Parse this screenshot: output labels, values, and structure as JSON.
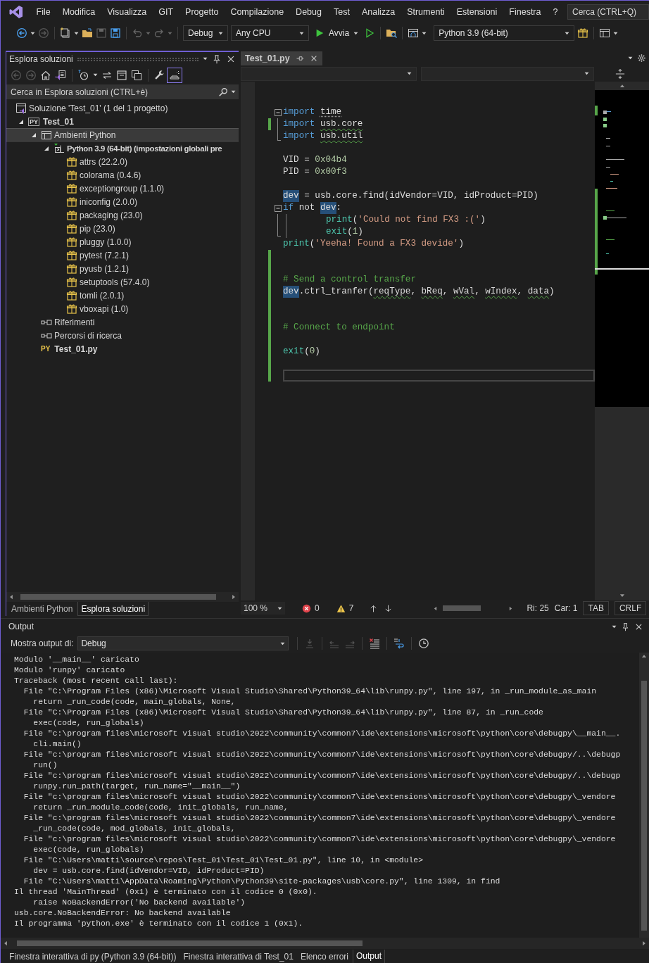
{
  "menu": {
    "items": [
      "File",
      "Modifica",
      "Visualizza",
      "GIT",
      "Progetto",
      "Compilazione",
      "Debug",
      "Test",
      "Analizza",
      "Strumenti",
      "Estensioni",
      "Finestra",
      "?"
    ],
    "search": {
      "placeholder": "Cerca (CTRL+Q)"
    }
  },
  "toolbar": {
    "configuration": "Debug",
    "platform": "Any CPU",
    "start": "Avvia",
    "environment": "Python 3.9 (64-bit)"
  },
  "solution_explorer": {
    "title": "Esplora soluzioni",
    "preview_on": true,
    "search": {
      "placeholder": "Cerca in Esplora soluzioni (CTRL+è)"
    },
    "tree": [
      {
        "kind": "solution",
        "label": "Soluzione 'Test_01' (1 del 1 progetto)",
        "selected": false,
        "children": [
          {
            "kind": "project",
            "badge": "PY",
            "label": "Test_01",
            "expanded": true,
            "selected": false,
            "children": [
              {
                "kind": "folder",
                "label": "Ambienti Python",
                "expanded": true,
                "selected": true,
                "children": [
                  {
                    "kind": "environment",
                    "label": "Python 3.9 (64-bit) (impostazioni globali pre",
                    "expanded": true,
                    "selected": false,
                    "children": [
                      {
                        "kind": "package",
                        "label": "attrs (22.2.0)",
                        "selected": false
                      },
                      {
                        "kind": "package",
                        "label": "colorama (0.4.6)",
                        "selected": false
                      },
                      {
                        "kind": "package",
                        "label": "exceptiongroup (1.1.0)",
                        "selected": false
                      },
                      {
                        "kind": "package",
                        "label": "iniconfig (2.0.0)",
                        "selected": false
                      },
                      {
                        "kind": "package",
                        "label": "packaging (23.0)",
                        "selected": false
                      },
                      {
                        "kind": "package",
                        "label": "pip (23.0)",
                        "selected": false
                      },
                      {
                        "kind": "package",
                        "label": "pluggy (1.0.0)",
                        "selected": false
                      },
                      {
                        "kind": "package",
                        "label": "pytest (7.2.1)",
                        "selected": false
                      },
                      {
                        "kind": "package",
                        "label": "pyusb (1.2.1)",
                        "selected": false
                      },
                      {
                        "kind": "package",
                        "label": "setuptools (57.4.0)",
                        "selected": false
                      },
                      {
                        "kind": "package",
                        "label": "tomli (2.0.1)",
                        "selected": false
                      },
                      {
                        "kind": "package",
                        "label": "vboxapi (1.0)",
                        "selected": false
                      }
                    ]
                  }
                ]
              },
              {
                "kind": "reference",
                "label": "Riferimenti",
                "selected": false
              },
              {
                "kind": "reference",
                "label": "Percorsi di ricerca",
                "selected": false
              },
              {
                "kind": "file",
                "badge": "PY",
                "label": "Test_01.py",
                "selected": false
              }
            ]
          }
        ]
      }
    ],
    "tabs": [
      {
        "label": "Ambienti Python",
        "selected": false
      },
      {
        "label": "Esplora soluzioni",
        "selected": true
      }
    ]
  },
  "editor": {
    "tabs": [
      {
        "label": "Test_01.py",
        "selected": true
      }
    ],
    "lines": [
      {
        "kind": "blank",
        "changed": false,
        "current": false
      },
      {
        "kind": "blank",
        "changed": false,
        "current": false
      },
      {
        "kind": "code",
        "changed": false,
        "current": false,
        "collapsible": true,
        "tokens": [
          {
            "t": "import ",
            "kind": "kw"
          },
          {
            "t": "time",
            "kind": "hint"
          }
        ]
      },
      {
        "kind": "code",
        "changed": true,
        "current": false,
        "in_block": true,
        "tokens": [
          {
            "t": "import ",
            "kind": "kw"
          },
          {
            "t": "usb.core",
            "kind": "err"
          }
        ]
      },
      {
        "kind": "code",
        "changed": false,
        "current": false,
        "block_end": true,
        "tokens": [
          {
            "t": "import ",
            "kind": "kw"
          },
          {
            "t": "usb.util",
            "kind": "err"
          }
        ]
      },
      {
        "kind": "blank",
        "changed": false,
        "current": false
      },
      {
        "kind": "code",
        "changed": false,
        "current": false,
        "tokens": [
          {
            "t": "VID = ",
            "kind": "id"
          },
          {
            "t": "0x04b4",
            "kind": "num"
          }
        ]
      },
      {
        "kind": "code",
        "changed": false,
        "current": false,
        "tokens": [
          {
            "t": "PID = ",
            "kind": "id"
          },
          {
            "t": "0x00f3",
            "kind": "num"
          }
        ]
      },
      {
        "kind": "blank",
        "changed": false,
        "current": false
      },
      {
        "kind": "code",
        "changed": false,
        "current": false,
        "tokens": [
          {
            "t": "dev",
            "kind": "ref"
          },
          {
            "t": " = usb.core.find(idVendor=VID, idProduct=PID)",
            "kind": "id"
          }
        ]
      },
      {
        "kind": "code",
        "changed": false,
        "current": false,
        "collapsible": true,
        "tokens": [
          {
            "t": "if",
            "kind": "kw"
          },
          {
            "t": " not ",
            "kind": "id"
          },
          {
            "t": "dev",
            "kind": "ref"
          },
          {
            "t": ":",
            "kind": "id"
          }
        ]
      },
      {
        "kind": "code",
        "changed": false,
        "current": false,
        "in_block": true,
        "indented": true,
        "tokens": [
          {
            "t": "print",
            "kind": "fn"
          },
          {
            "t": "(",
            "kind": "id"
          },
          {
            "t": "'Could not find FX3 :('",
            "kind": "str"
          },
          {
            "t": ")",
            "kind": "id"
          }
        ]
      },
      {
        "kind": "code",
        "changed": false,
        "current": false,
        "block_end": true,
        "indented": true,
        "tokens": [
          {
            "t": "exit",
            "kind": "fn"
          },
          {
            "t": "(",
            "kind": "id"
          },
          {
            "t": "1",
            "kind": "num"
          },
          {
            "t": ")",
            "kind": "id"
          }
        ]
      },
      {
        "kind": "code",
        "changed": false,
        "current": false,
        "tokens": [
          {
            "t": "print",
            "kind": "fn"
          },
          {
            "t": "(",
            "kind": "id"
          },
          {
            "t": "'Yeeha! Found a FX3 devide'",
            "kind": "str"
          },
          {
            "t": ")",
            "kind": "id"
          }
        ]
      },
      {
        "kind": "blank",
        "changed": true,
        "current": false
      },
      {
        "kind": "blank",
        "changed": true,
        "current": false
      },
      {
        "kind": "code",
        "changed": true,
        "current": false,
        "tokens": [
          {
            "t": "# Send a control transfer",
            "kind": "cm"
          }
        ]
      },
      {
        "kind": "code",
        "changed": true,
        "current": false,
        "tokens": [
          {
            "t": "dev",
            "kind": "ref"
          },
          {
            "t": ".ctrl_tranfer(",
            "kind": "id"
          },
          {
            "t": "reqType",
            "kind": "err"
          },
          {
            "t": ", ",
            "kind": "id"
          },
          {
            "t": "bReq",
            "kind": "err"
          },
          {
            "t": ", ",
            "kind": "id"
          },
          {
            "t": "wVal",
            "kind": "err"
          },
          {
            "t": ", ",
            "kind": "id"
          },
          {
            "t": "wIndex",
            "kind": "err"
          },
          {
            "t": ", ",
            "kind": "id"
          },
          {
            "t": "data",
            "kind": "err"
          },
          {
            "t": ")",
            "kind": "id"
          }
        ]
      },
      {
        "kind": "blank",
        "changed": true,
        "current": false
      },
      {
        "kind": "blank",
        "changed": true,
        "current": false
      },
      {
        "kind": "code",
        "changed": true,
        "current": false,
        "tokens": [
          {
            "t": "# Connect to endpoint",
            "kind": "cm"
          }
        ]
      },
      {
        "kind": "blank",
        "changed": true,
        "current": false
      },
      {
        "kind": "code",
        "changed": true,
        "current": false,
        "tokens": [
          {
            "t": "exit",
            "kind": "fn"
          },
          {
            "t": "(",
            "kind": "id"
          },
          {
            "t": "0",
            "kind": "num"
          },
          {
            "t": ")",
            "kind": "id"
          }
        ]
      },
      {
        "kind": "blank",
        "changed": true,
        "current": false
      },
      {
        "kind": "blank",
        "changed": true,
        "current": true
      }
    ],
    "status": {
      "zoom": "100 %",
      "errors": "0",
      "warnings": "7",
      "line": "Ri: 25",
      "column": "Car: 1",
      "indent": "TAB",
      "line_ending": "CRLF"
    }
  },
  "output": {
    "title": "Output",
    "source_label": "Mostra output di:",
    "source": "Debug",
    "lines": [
      "Modulo '__main__' caricato",
      "Modulo 'runpy' caricato",
      "Traceback (most recent call last):",
      "  File \"C:\\Program Files (x86)\\Microsoft Visual Studio\\Shared\\Python39_64\\lib\\runpy.py\", line 197, in _run_module_as_main",
      "    return _run_code(code, main_globals, None,",
      "  File \"C:\\Program Files (x86)\\Microsoft Visual Studio\\Shared\\Python39_64\\lib\\runpy.py\", line 87, in _run_code",
      "    exec(code, run_globals)",
      "  File \"c:\\program files\\microsoft visual studio\\2022\\community\\common7\\ide\\extensions\\microsoft\\python\\core\\debugpy\\__main__.",
      "    cli.main()",
      "  File \"c:\\program files\\microsoft visual studio\\2022\\community\\common7\\ide\\extensions\\microsoft\\python\\core\\debugpy/..\\debugp",
      "    run()",
      "  File \"c:\\program files\\microsoft visual studio\\2022\\community\\common7\\ide\\extensions\\microsoft\\python\\core\\debugpy/..\\debugp",
      "    runpy.run_path(target, run_name=\"__main__\")",
      "  File \"c:\\program files\\microsoft visual studio\\2022\\community\\common7\\ide\\extensions\\microsoft\\python\\core\\debugpy\\_vendore",
      "    return _run_module_code(code, init_globals, run_name,",
      "  File \"c:\\program files\\microsoft visual studio\\2022\\community\\common7\\ide\\extensions\\microsoft\\python\\core\\debugpy\\_vendore",
      "    _run_code(code, mod_globals, init_globals,",
      "  File \"c:\\program files\\microsoft visual studio\\2022\\community\\common7\\ide\\extensions\\microsoft\\python\\core\\debugpy\\_vendore",
      "    exec(code, run_globals)",
      "  File \"C:\\Users\\matti\\source\\repos\\Test_01\\Test_01\\Test_01.py\", line 10, in <module>",
      "    dev = usb.core.find(idVendor=VID, idProduct=PID)",
      "  File \"C:\\Users\\matti\\AppData\\Roaming\\Python\\Python39\\site-packages\\usb\\core.py\", line 1309, in find",
      "Il thread 'MainThread' (0x1) è terminato con il codice 0 (0x0).",
      "    raise NoBackendError('No backend available')",
      "usb.core.NoBackendError: No backend available",
      "Il programma 'python.exe' è terminato con il codice 1 (0x1)."
    ]
  },
  "bottom_tabs": [
    {
      "label": "Finestra interattiva di py (Python 3.9 (64-bit))",
      "selected": false
    },
    {
      "label": "Finestra interattiva di Test_01",
      "selected": false
    },
    {
      "label": "Elenco errori",
      "selected": false
    },
    {
      "label": "Output",
      "selected": true
    }
  ]
}
